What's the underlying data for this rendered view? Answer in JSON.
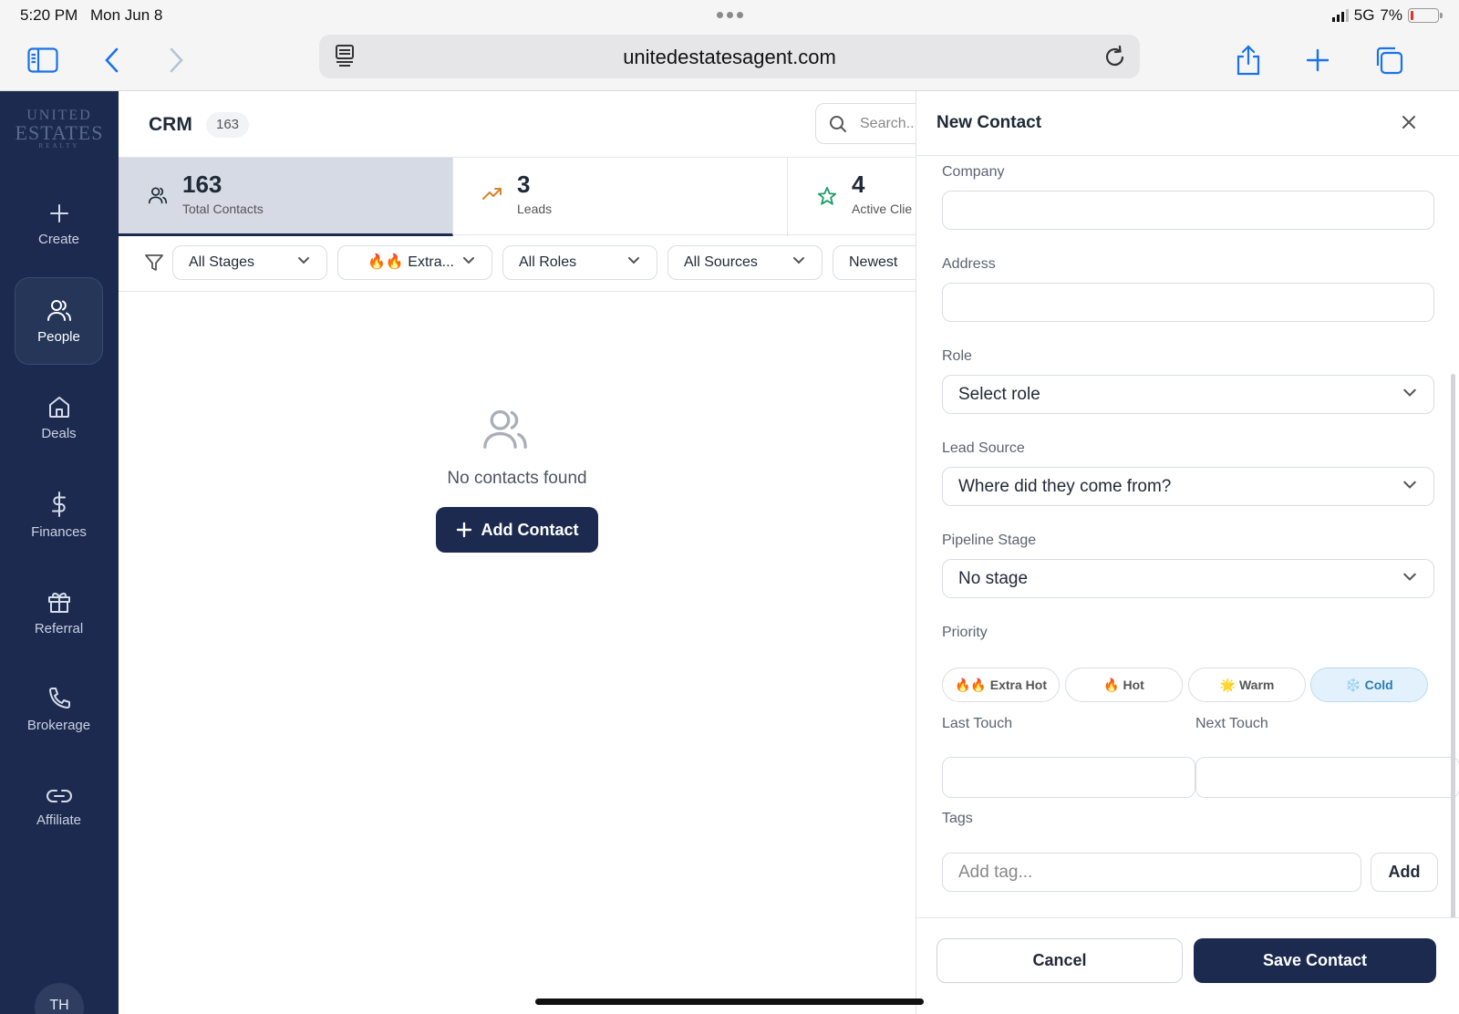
{
  "status_bar": {
    "time": "5:20 PM",
    "date": "Mon Jun 8",
    "network": "5G",
    "battery": "7%"
  },
  "browser": {
    "url": "unitedestatesagent.com",
    "icons": [
      "sidebar-icon",
      "back-icon",
      "forward-icon",
      "reader-icon",
      "reload-icon",
      "share-icon",
      "new-tab-icon",
      "tabs-icon"
    ]
  },
  "brand": {
    "logo_line1": "UNITED",
    "logo_line2": "ESTATES",
    "logo_line3": "REALTY"
  },
  "sidebar": {
    "items": [
      {
        "label": "Create",
        "icon": "plus-icon"
      },
      {
        "label": "People",
        "icon": "people-icon",
        "active": true
      },
      {
        "label": "Deals",
        "icon": "home-icon"
      },
      {
        "label": "Finances",
        "icon": "dollar-icon"
      },
      {
        "label": "Referral",
        "icon": "gift-icon"
      },
      {
        "label": "Brokerage",
        "icon": "phone-icon"
      },
      {
        "label": "Affiliate",
        "icon": "link-icon"
      }
    ],
    "avatar_initials": "TH"
  },
  "crm": {
    "title": "CRM",
    "count": "163",
    "search_placeholder": "Search...",
    "stats": [
      {
        "value": "163",
        "label": "Total Contacts",
        "icon": "people-icon"
      },
      {
        "value": "3",
        "label": "Leads",
        "icon": "trending-up-icon"
      },
      {
        "value": "4",
        "label": "Active Clie",
        "icon": "star-icon"
      }
    ],
    "filters": {
      "stages": "All Stages",
      "priority": "🔥🔥 Extra...",
      "roles": "All Roles",
      "sources": "All Sources",
      "sort": "Newest"
    },
    "empty_text": "No contacts found",
    "add_contact": "Add Contact"
  },
  "drawer": {
    "title": "New Contact",
    "company_label": "Company",
    "address_label": "Address",
    "role_label": "Role",
    "role_value": "Select role",
    "lead_source_label": "Lead Source",
    "lead_source_value": "Where did they come from?",
    "pipeline_label": "Pipeline Stage",
    "pipeline_value": "No stage",
    "priority_label": "Priority",
    "priorities": [
      {
        "label": "🔥🔥 Extra Hot"
      },
      {
        "label": "🔥 Hot"
      },
      {
        "label": "🌟 Warm"
      },
      {
        "label": "❄️ Cold",
        "selected": true
      }
    ],
    "last_touch_label": "Last Touch",
    "next_touch_label": "Next Touch",
    "tags_label": "Tags",
    "tags_placeholder": "Add tag...",
    "tags_add": "Add",
    "cancel": "Cancel",
    "save": "Save Contact"
  },
  "colors": {
    "navy": "#1b2a4e",
    "cold_bg": "#e2f1fb",
    "link_blue": "#1a73e8"
  }
}
